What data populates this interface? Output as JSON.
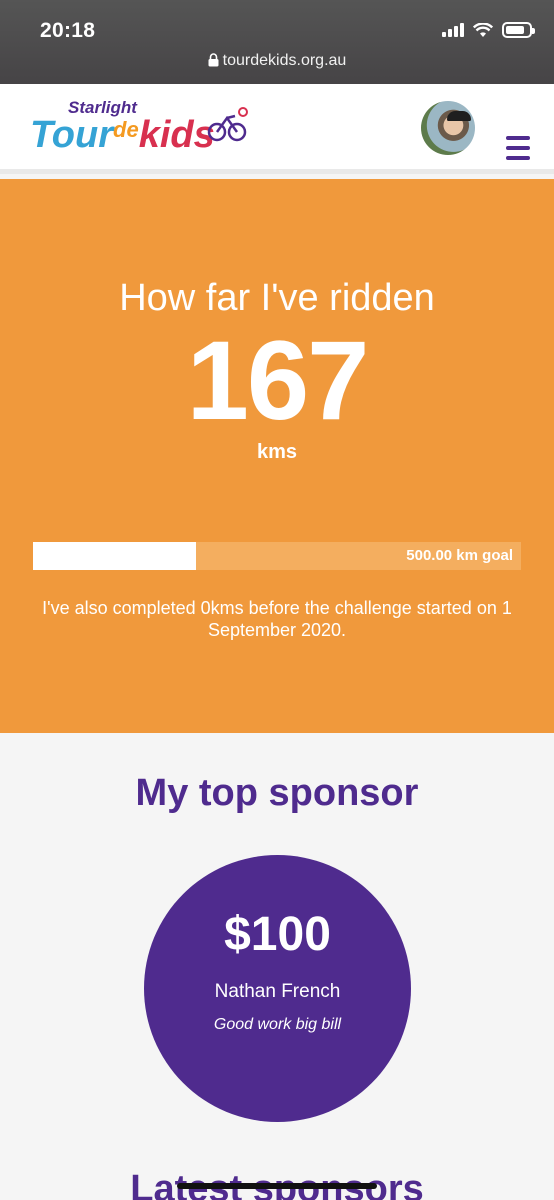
{
  "status_bar": {
    "time": "20:18",
    "url": "tourdekids.org.au"
  },
  "header": {
    "logo": {
      "starlight": "Starlight",
      "tour": "Tour",
      "de": "de",
      "kids": "kids"
    },
    "menu_icon": "hamburger-icon"
  },
  "progress": {
    "title": "How far I've ridden",
    "distance": "167",
    "unit": "kms",
    "fraction": 0.334,
    "goal_label": "500.00 km goal",
    "prior_text": "I've also completed 0kms before the challenge started on 1 September 2020."
  },
  "top_sponsor": {
    "heading": "My top sponsor",
    "amount": "$100",
    "name": "Nathan French",
    "message": "Good work big bill"
  },
  "latest_sponsors": {
    "heading": "Latest sponsors"
  },
  "colors": {
    "orange": "#f0993c",
    "purple": "#4f2b8e",
    "blue": "#35a3d5",
    "red": "#d8304f"
  }
}
